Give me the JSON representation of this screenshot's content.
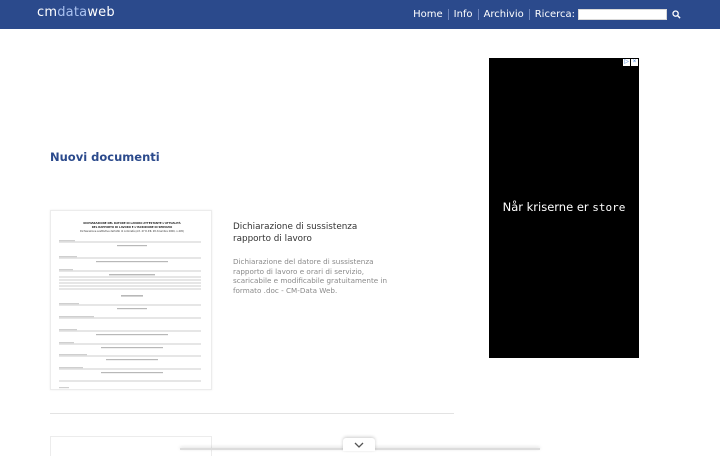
{
  "header": {
    "logo_prefix": "cm",
    "logo_mid": "data",
    "logo_suffix": "web",
    "nav": [
      "Home",
      "Info",
      "Archivio"
    ],
    "search_label": "Ricerca:",
    "search_value": "",
    "search_icon": "search-icon"
  },
  "main": {
    "section_title": "Nuovi documenti",
    "documents": [
      {
        "title": "Dichiarazione di sussistenza rapporto di lavoro",
        "description": "Dichiarazione del datore di sussistenza rapporto di lavoro e orari di servizio, scaricabile e modificabile gratuitamente in formato .doc - CM-Data Web.",
        "thumbnail_heading": "DICHIARAZIONE DEL DATORE DI LAVORO ATTESTANTE L'ATTUALITÀ DEL RAPPORTO DI LAVORO E L'ISCRIZIONE DI SERVIZIO",
        "thumbnail_subheading": "Dichiarazione sostitutiva dell'atto di notorietà (Art. 47 D.P.R. 28 dicembre 2000, n.445)"
      }
    ]
  },
  "ad": {
    "text": "Når kriserne er",
    "brand": "store",
    "choices_icons": [
      "ad-info-icon",
      "ad-close-icon"
    ]
  },
  "colors": {
    "header_bg": "#2b4a8c",
    "accent": "#2b4a8c",
    "ad_bg": "#000000"
  },
  "bottom": {
    "chevron_icon": "chevron-down-icon"
  }
}
